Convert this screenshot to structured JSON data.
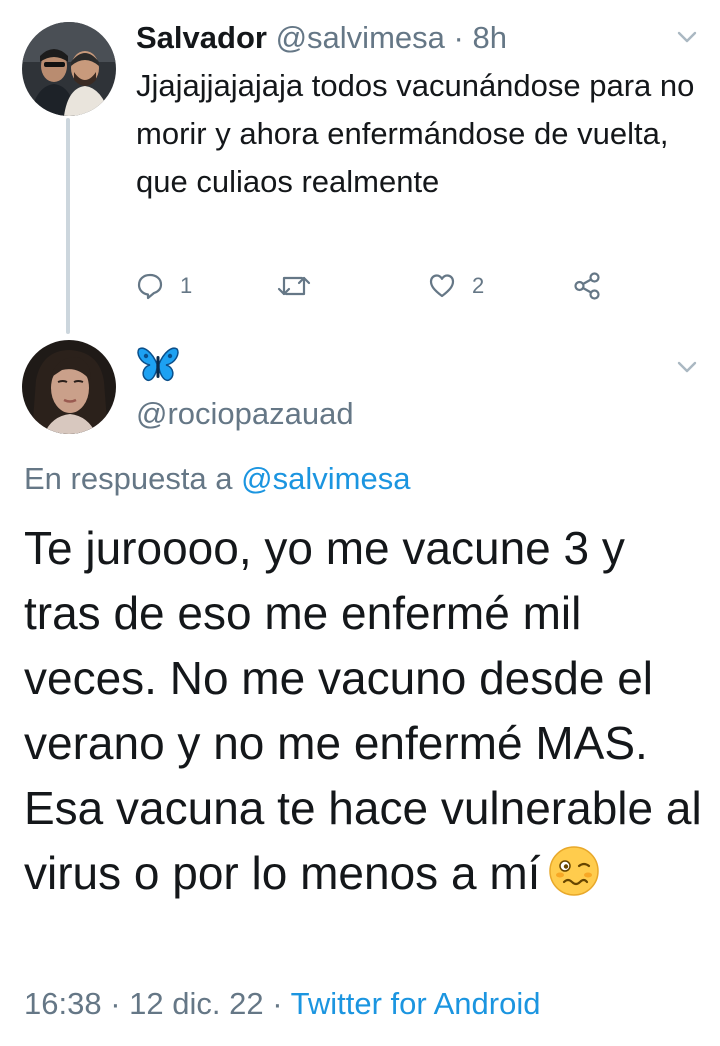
{
  "tweet1": {
    "display_name": "Salvador",
    "handle": "@salvimesa",
    "separator": "·",
    "time": "8h",
    "text": "Jjajajjajajaja todos vacunándose para no morir y ahora enfermándose de vuelta, que culiaos realmente",
    "reply_count": "1",
    "like_count": "2",
    "icons": [
      "reply-icon",
      "retweet-icon",
      "like-icon",
      "share-icon",
      "chevron-down-icon"
    ]
  },
  "tweet2": {
    "display_name": "🦋",
    "handle": "@rociopazauad",
    "replying_prefix": "En respuesta a",
    "replying_to": "@salvimesa",
    "text": "Te juroooo, yo me vacune 3 y tras de eso me enfermé mil veces. No me vacuno desde el verano y no me enfermé MAS. Esa vacuna te hace vulnerable al virus o por lo menos a mí",
    "emoji": "woozy-face",
    "time": "16:38",
    "separator": "·",
    "date": "12 dic. 22",
    "source": "Twitter for Android"
  },
  "colors": {
    "text": "#14171a",
    "secondary": "#657786",
    "link": "#1b95e0",
    "thread_line": "#ccd6dd",
    "butterfly": "#1da1f2"
  }
}
